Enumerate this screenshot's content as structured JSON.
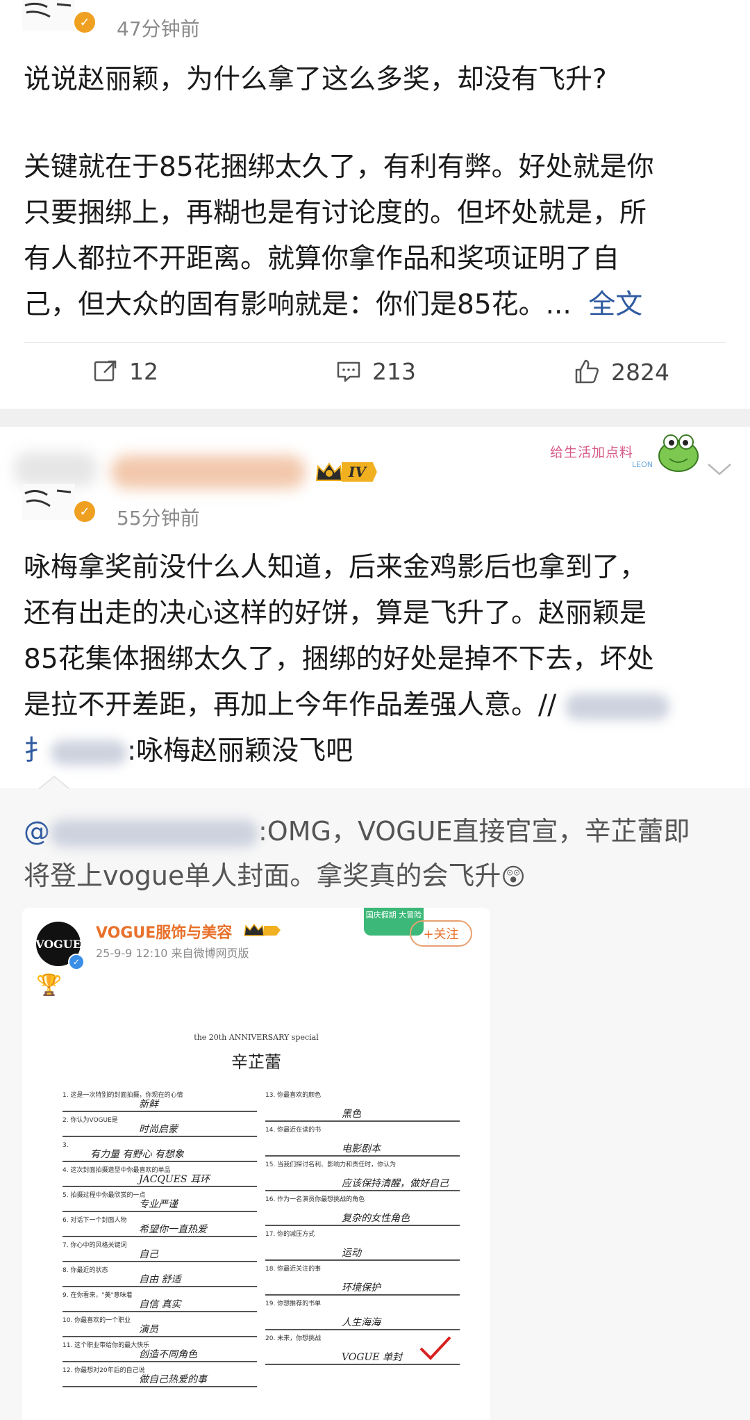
{
  "post1": {
    "time": "47分钟前",
    "title_line": "说说赵丽颖，为什么拿了这么多奖，却没有飞升?",
    "body_lines": [
      "关键就在于85花捆绑太久了，有利有弊。好处就是你",
      "只要捆绑上，再糊也是有讨论度的。但坏处就是，所",
      "有人都拉不开距离。就算你拿作品和奖项证明了自",
      "己，但大众的固有影响就是：你们是85花。..."
    ],
    "full_text_link": "全文",
    "actions": {
      "repost": "12",
      "comment": "213",
      "like": "2824"
    }
  },
  "post2": {
    "time": "55分钟前",
    "level_badge": "IV",
    "sticker_text": "给生活加点料",
    "sticker_sub": "LEON",
    "body_lines": [
      "咏梅拿奖前没什么人知道，后来金鸡影后也拿到了，",
      "还有出走的决心这样的好饼，算是飞升了。赵丽颖是",
      "85花集体捆绑太久了，捆绑的好处是掉不下去，坏处",
      "是拉不开差距，再加上今年作品差强人意。//"
    ],
    "last_line_tail": ":咏梅赵丽颖没飞吧",
    "last_line_head": "扌",
    "quote": {
      "at": "@",
      "line1_tail": ":OMG，VOGUE直接官宣，辛芷蕾即",
      "line2": "将登上vogue单人封面。拿奖真的会飞升",
      "emoji": "😲"
    }
  },
  "embedded": {
    "account_name": "VOGUE服饰与美容",
    "avatar_text": "VOGUE",
    "meta": "25-9-9 12:10  来自微博网页版",
    "follow_button": "+关注",
    "sticker": "国庆假期 大冒险",
    "doc_header": "the 20th ANNIVERSARY special",
    "doc_name": "辛芷蕾",
    "left_questions": [
      {
        "num": "1.",
        "q": "这是一次特别的封面拍摄，你现在的心情",
        "a": "新鲜"
      },
      {
        "num": "2.",
        "q": "你认为VOGUE是",
        "a": "时尚启蒙"
      },
      {
        "num": "3.",
        "q": "",
        "a": "有力量 有野心 有想象"
      },
      {
        "num": "4.",
        "q": "这次封面拍摄造型中你最喜欢的单品",
        "a": "JACQUES 耳环"
      },
      {
        "num": "5.",
        "q": "拍摄过程中你最欣赏的一点",
        "a": "专业严谨"
      },
      {
        "num": "6.",
        "q": "对话下一个封面人物",
        "a": "希望你一直热爱"
      },
      {
        "num": "7.",
        "q": "你心中的风格关键词",
        "a": "自己"
      },
      {
        "num": "8.",
        "q": "你最近的状态",
        "a": "自由 舒适"
      },
      {
        "num": "9.",
        "q": "在你看来，\"美\"意味着",
        "a": "自信 真实"
      },
      {
        "num": "10.",
        "q": "你最喜欢的一个职业",
        "a": "演员"
      },
      {
        "num": "11.",
        "q": "这个职业带给你的最大快乐",
        "a": "创造不同角色"
      },
      {
        "num": "12.",
        "q": "你最想对20年后的自己说",
        "a": "做自己热爱的事"
      }
    ],
    "right_questions": [
      {
        "num": "13.",
        "q": "你最喜欢的颜色",
        "a": "黑色"
      },
      {
        "num": "14.",
        "q": "你最近在读的书",
        "a": "电影剧本"
      },
      {
        "num": "15.",
        "q": "当我们探讨名利、影响力和责任时，你认为",
        "a": "应该保持清醒，做好自己"
      },
      {
        "num": "16.",
        "q": "作为一名演员你最想挑战的角色",
        "a": "复杂的女性角色"
      },
      {
        "num": "17.",
        "q": "你的减压方式",
        "a": "运动"
      },
      {
        "num": "18.",
        "q": "你最近关注的事",
        "a": "环境保护"
      },
      {
        "num": "19.",
        "q": "你想推荐的书单",
        "a": "人生海海"
      },
      {
        "num": "20.",
        "q": "未来，你想挑战",
        "a": "VOGUE 单封"
      }
    ]
  },
  "colors": {
    "link_blue": "#2f5aa0",
    "gray_text": "#8b8b8b",
    "orange_badge": "#f0a020",
    "separator": "#f0f0f0",
    "vogue_orange": "#e8702a",
    "check_red": "#d82020"
  }
}
